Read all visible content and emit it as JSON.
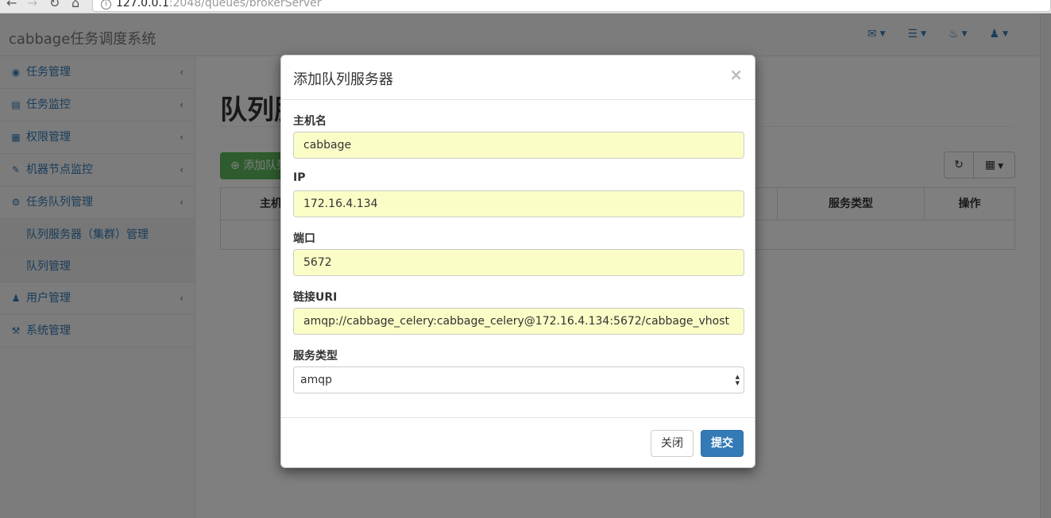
{
  "browser": {
    "url_host": "127.0.0.1",
    "url_rest": ":2048/queues/brokerServer"
  },
  "navbar": {
    "brand": "cabbage任务调度系统",
    "icons": [
      "envelope-icon",
      "tasks-icon",
      "bell-icon",
      "user-icon"
    ]
  },
  "sidebar": {
    "items": [
      {
        "label": "任务管理",
        "icon": "dashboard-icon"
      },
      {
        "label": "任务监控",
        "icon": "bar-chart-icon"
      },
      {
        "label": "权限管理",
        "icon": "table-icon"
      },
      {
        "label": "机器节点监控",
        "icon": "edit-icon"
      },
      {
        "label": "任务队列管理",
        "icon": "gear-icon"
      }
    ],
    "subitems": [
      "队列服务器（集群）管理",
      "队列管理"
    ],
    "items_after": [
      {
        "label": "用户管理",
        "icon": "user-icon"
      },
      {
        "label": "系统管理",
        "icon": "wrench-icon"
      }
    ]
  },
  "main": {
    "title": "队列服务器",
    "add_button": "添加队列服务器",
    "table_headers": [
      "主机名",
      "服务类型",
      "操作"
    ]
  },
  "modal": {
    "title": "添加队列服务器",
    "close_symbol": "×",
    "fields": {
      "hostname": {
        "label": "主机名",
        "value": "cabbage"
      },
      "ip": {
        "label": "IP",
        "value": "172.16.4.134"
      },
      "port": {
        "label": "端口",
        "value": "5672"
      },
      "uri": {
        "label": "链接URI",
        "value": "amqp://cabbage_celery:cabbage_celery@172.16.4.134:5672/cabbage_vhost"
      },
      "service_type": {
        "label": "服务类型",
        "value": "amqp"
      }
    },
    "close_button": "关闭",
    "submit_button": "提交"
  }
}
